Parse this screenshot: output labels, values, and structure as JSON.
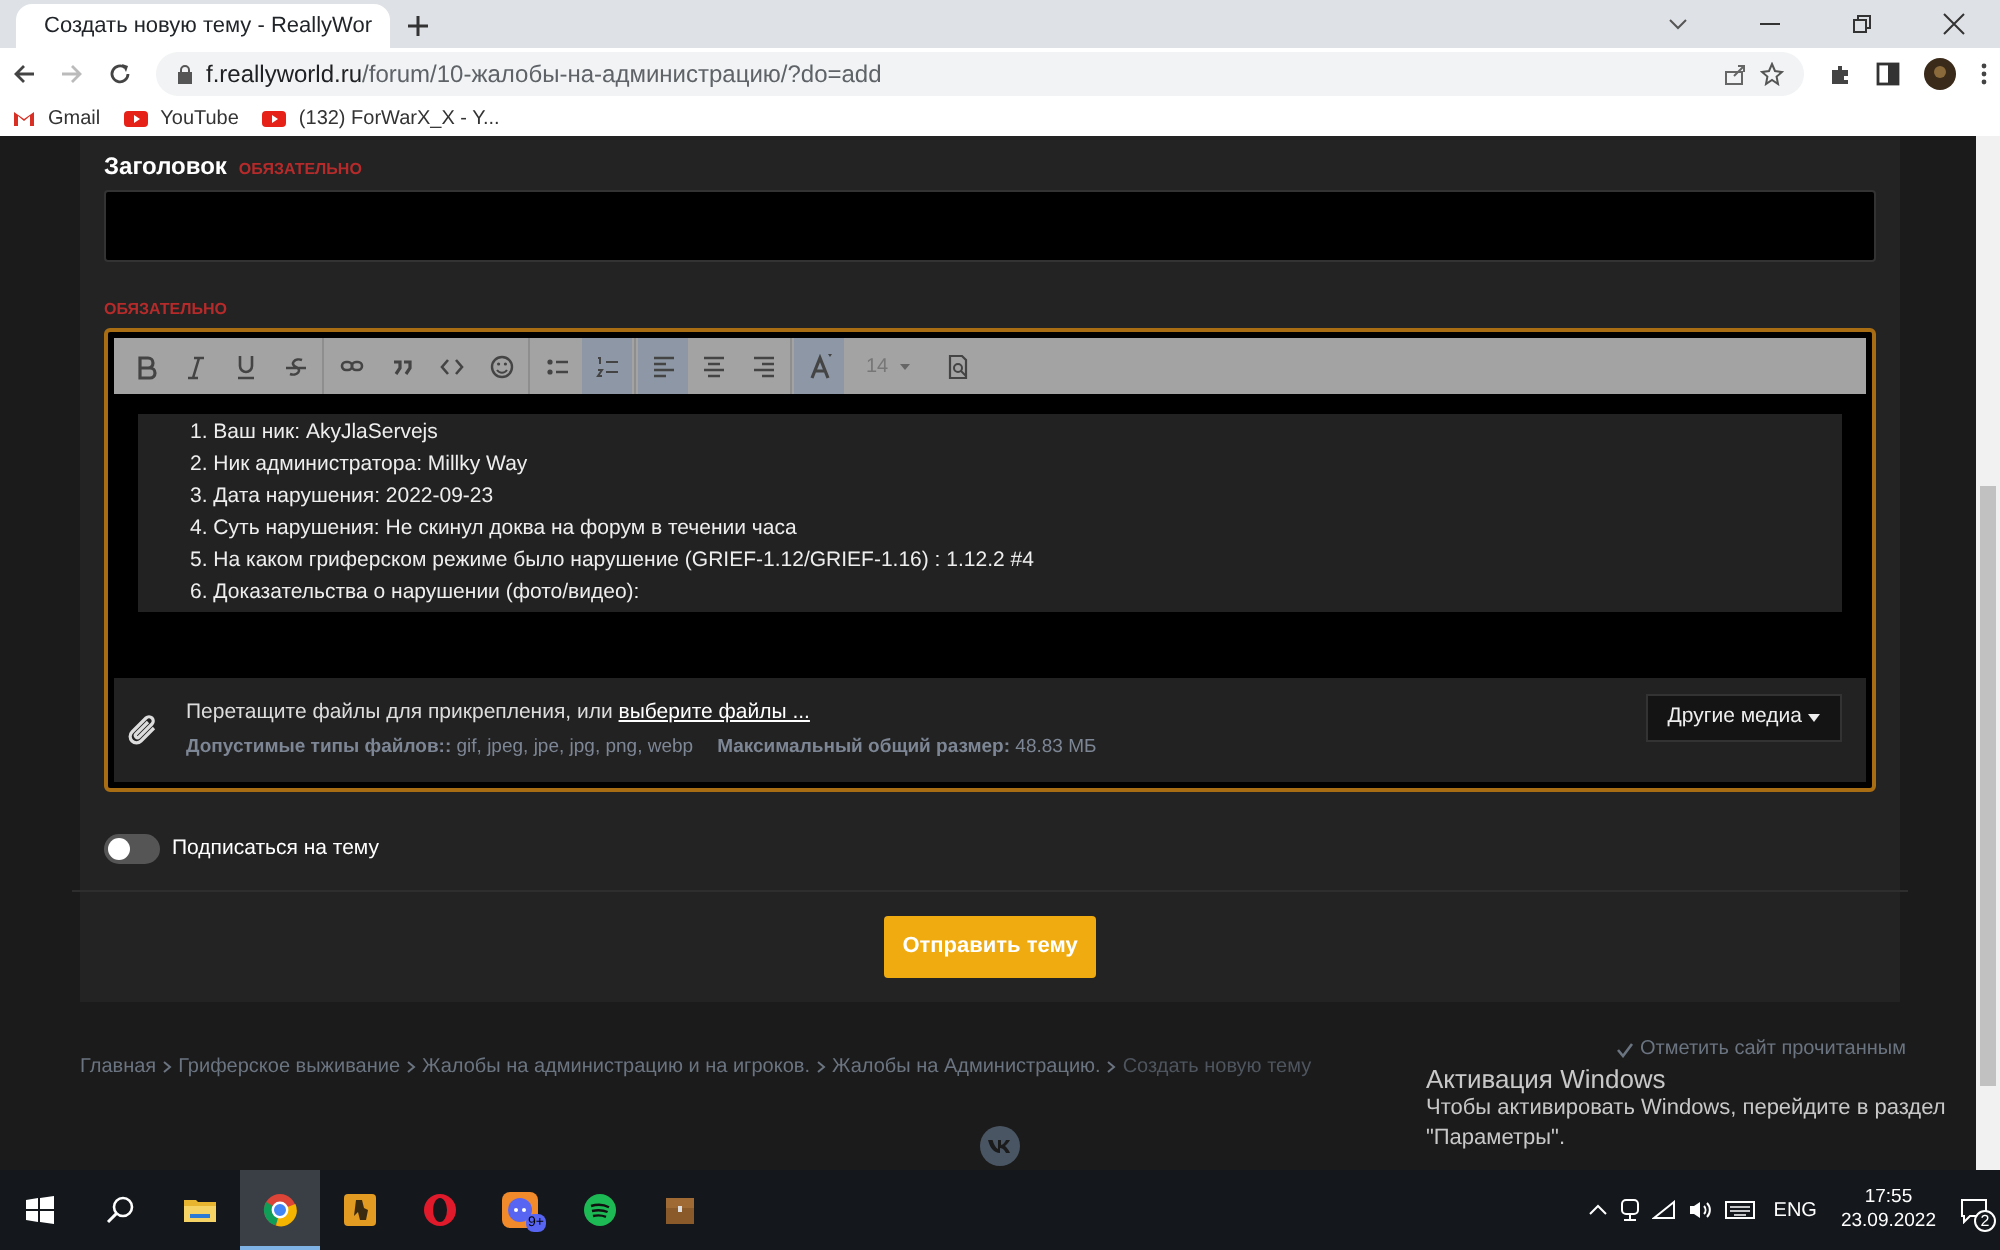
{
  "browser": {
    "tab_title": "Создать новую тему - ReallyWor",
    "url_host": "f.reallyworld.ru",
    "url_path": "/forum/10-жалобы-на-администрацию/?do=add",
    "bookmarks": [
      {
        "kind": "gmail",
        "label": "Gmail"
      },
      {
        "kind": "youtube",
        "label": "YouTube"
      },
      {
        "kind": "youtube",
        "label": "(132) ForWarX_X - Y..."
      }
    ]
  },
  "form": {
    "title_label": "Заголовок",
    "title_required": "ОБЯЗАТЕЛЬНО",
    "body_required": "ОБЯЗАТЕЛЬНО",
    "toolbar": [
      {
        "kind": "bold",
        "selected": false
      },
      {
        "kind": "italic",
        "selected": false
      },
      {
        "kind": "underline",
        "selected": false
      },
      {
        "kind": "strike",
        "selected": false
      },
      {
        "kind": "sep"
      },
      {
        "kind": "link",
        "selected": false
      },
      {
        "kind": "quote",
        "selected": false
      },
      {
        "kind": "code",
        "selected": false
      },
      {
        "kind": "emoji",
        "selected": false
      },
      {
        "kind": "sep"
      },
      {
        "kind": "bullets",
        "selected": false
      },
      {
        "kind": "numbers",
        "selected": true
      },
      {
        "kind": "sep"
      },
      {
        "kind": "align-left",
        "selected": true
      },
      {
        "kind": "align-center",
        "selected": false
      },
      {
        "kind": "align-right",
        "selected": false
      },
      {
        "kind": "sep"
      },
      {
        "kind": "color",
        "selected": true
      },
      {
        "kind": "font-size",
        "value": "14"
      },
      {
        "kind": "preview",
        "selected": false
      }
    ],
    "body_lines": [
      "1. Ваш ник: AkyJlaServejs",
      "2. Ник администратора: Millky Way",
      "3. Дата нарушения: 2022-09-23",
      "4. Суть нарушения: Не скинул доква на форум в течении часа",
      "5. На каком гриферском режиме было нарушение (GRIEF-1.12/GRIEF-1.16) : 1.12.2 #4",
      "6. Доказательства о нарушении (фото/видео):"
    ],
    "attach_text": "Перетащите файлы для прикрепления, или",
    "attach_link": "выберите файлы ...",
    "allowed_label": "Допустимые типы файлов::",
    "allowed_value": "gif, jpeg, jpe, jpg, png, webp",
    "max_label": "Максимальный общий размер:",
    "max_value": "48.83 МБ",
    "media_button": "Другие медиа",
    "subscribe": {
      "label": "Подписаться на тему",
      "on": false
    },
    "submit": "Отправить тему"
  },
  "breadcrumbs": [
    {
      "label": "Главная",
      "current": false
    },
    {
      "label": "Гриферское выживание",
      "current": false
    },
    {
      "label": "Жалобы на администрацию и на игроков.",
      "current": false
    },
    {
      "label": "Жалобы на Администрацию.",
      "current": false
    },
    {
      "label": "Создать новую тему",
      "current": true
    }
  ],
  "mark_read": "Отметить сайт прочитанным",
  "activation": {
    "title": "Активация Windows",
    "text": "Чтобы активировать Windows, перейдите в раздел \"Параметры\"."
  },
  "taskbar": {
    "apps": [
      {
        "kind": "explorer",
        "active": false
      },
      {
        "kind": "chrome",
        "active": true
      },
      {
        "kind": "game",
        "active": false
      },
      {
        "kind": "opera",
        "active": false
      },
      {
        "kind": "discord",
        "active": false,
        "badge": "9+"
      },
      {
        "kind": "spotify",
        "active": false
      },
      {
        "kind": "chest",
        "active": false
      }
    ],
    "lang": "ENG",
    "time": "17:55",
    "date": "23.09.2022",
    "notifications": "2"
  }
}
